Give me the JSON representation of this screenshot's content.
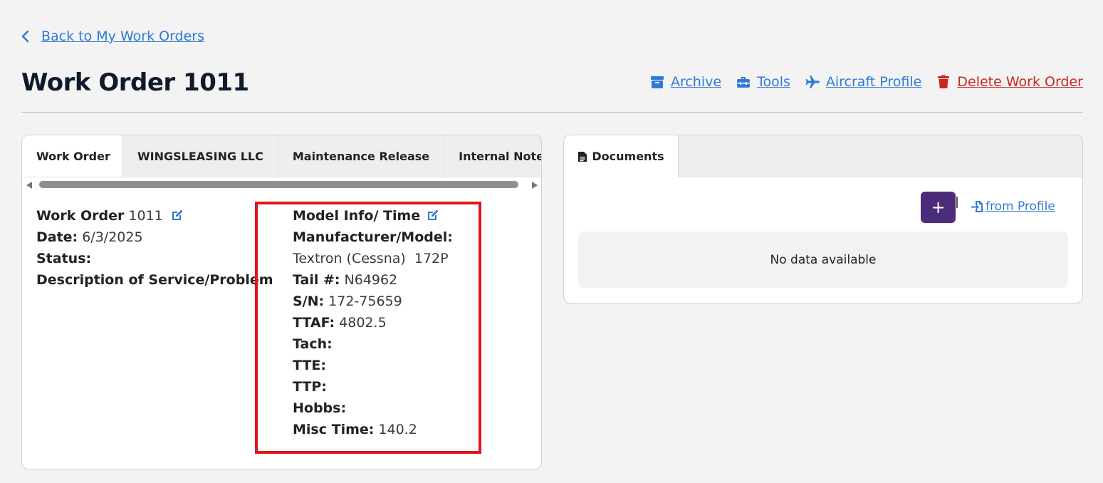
{
  "nav": {
    "back_label": "Back to My Work Orders"
  },
  "header": {
    "title": "Work Order 1011",
    "actions": {
      "archive": "Archive",
      "tools": "Tools",
      "aircraft_profile": "Aircraft Profile",
      "delete": "Delete Work Order"
    }
  },
  "tabs": [
    "Work Order",
    "WINGSLEASING LLC",
    "Maintenance Release",
    "Internal Notes"
  ],
  "work_order": {
    "label": "Work Order",
    "number": "1011",
    "date_label": "Date:",
    "date": "6/3/2025",
    "status_label": "Status:",
    "description_label": "Description of Service/Problem"
  },
  "model_info": {
    "heading": "Model Info/ Time",
    "manufacturer_label": "Manufacturer/Model:",
    "manufacturer_value": "Textron (Cessna)  172P",
    "tail_label": "Tail #:",
    "tail_value": "N64962",
    "sn_label": "S/N:",
    "sn_value": "172-75659",
    "ttaf_label": "TTAF:",
    "ttaf_value": "4802.5",
    "tach_label": "Tach:",
    "tte_label": "TTE:",
    "ttp_label": "TTP:",
    "hobbs_label": "Hobbs:",
    "misc_label": "Misc Time:",
    "misc_value": "140.2"
  },
  "documents": {
    "tab_label": "Documents",
    "add_label": "+",
    "from_profile_label": "from Profile",
    "empty_text": "No data available"
  },
  "colors": {
    "link": "#2f7ad6",
    "danger": "#c9271f",
    "primary_button": "#4b2c7a",
    "highlight": "#e0141b"
  }
}
